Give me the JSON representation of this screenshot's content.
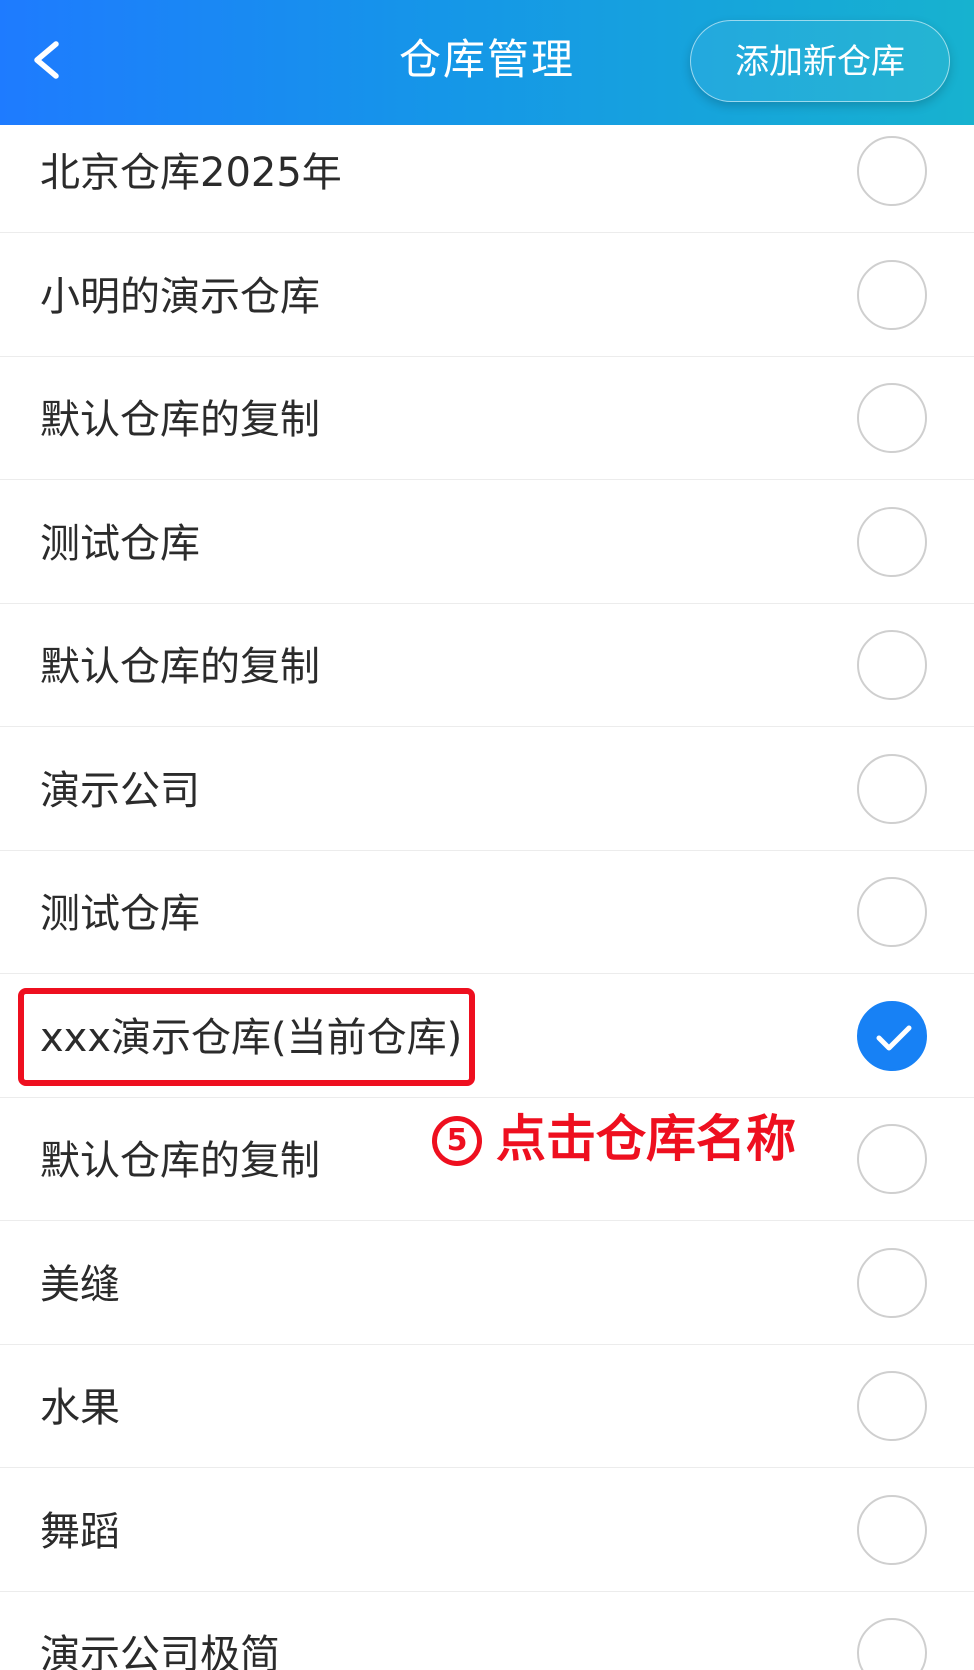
{
  "header": {
    "title": "仓库管理",
    "add_button_label": "添加新仓库"
  },
  "warehouses": [
    {
      "name": "北京仓库2025年",
      "selected": false
    },
    {
      "name": "小明的演示仓库",
      "selected": false
    },
    {
      "name": "默认仓库的复制",
      "selected": false
    },
    {
      "name": "测试仓库",
      "selected": false
    },
    {
      "name": "默认仓库的复制",
      "selected": false
    },
    {
      "name": "演示公司",
      "selected": false
    },
    {
      "name": "测试仓库",
      "selected": false
    },
    {
      "name": "xxx演示仓库(当前仓库)",
      "selected": true
    },
    {
      "name": "默认仓库的复制",
      "selected": false
    },
    {
      "name": "美缝",
      "selected": false
    },
    {
      "name": "水果",
      "selected": false
    },
    {
      "name": "舞蹈",
      "selected": false
    },
    {
      "name": "演示公司极简",
      "selected": false
    }
  ],
  "annotation": {
    "step": "5",
    "text": "点击仓库名称"
  },
  "colors": {
    "header_start": "#1e7bff",
    "header_end": "#17b2cf",
    "selected": "#1781f5",
    "annotation": "#ee0f1f"
  }
}
